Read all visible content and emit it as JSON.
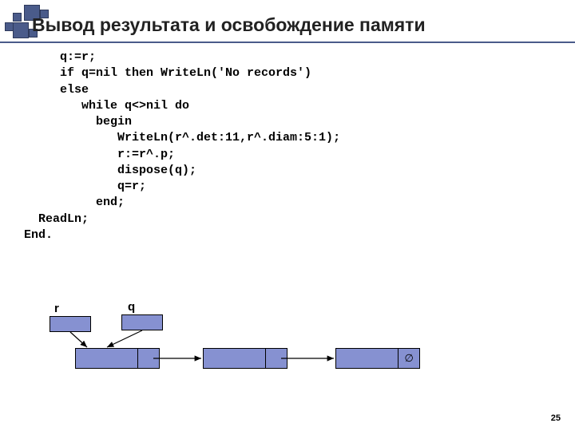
{
  "title": "Вывод результата и освобождение памяти",
  "code": "     q:=r;\n     if q=nil then WriteLn('No records')\n     else\n        while q<>nil do\n          begin\n             WriteLn(r^.det:11,r^.diam:5:1);\n             r:=r^.p;\n             dispose(q);\n             q=r;\n          end;\n  ReadLn;\nEnd.",
  "diagram": {
    "r_label": "r",
    "q_label": "q",
    "null_symbol": "∅"
  },
  "page_number": "25"
}
